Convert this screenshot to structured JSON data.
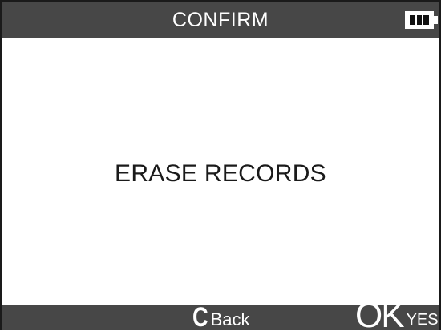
{
  "header": {
    "title": "CONFIRM",
    "battery_icon": "battery-full-icon",
    "battery_level": 1.0
  },
  "main": {
    "message": "ERASE RECORDS"
  },
  "footer": {
    "back_key": "C",
    "back_label": "Back",
    "ok_key": "OK",
    "ok_label": "YES"
  },
  "colors": {
    "bar_background": "#474747",
    "screen_background": "#ffffff",
    "text_dark": "#1a1a1a",
    "text_light": "#ffffff"
  }
}
